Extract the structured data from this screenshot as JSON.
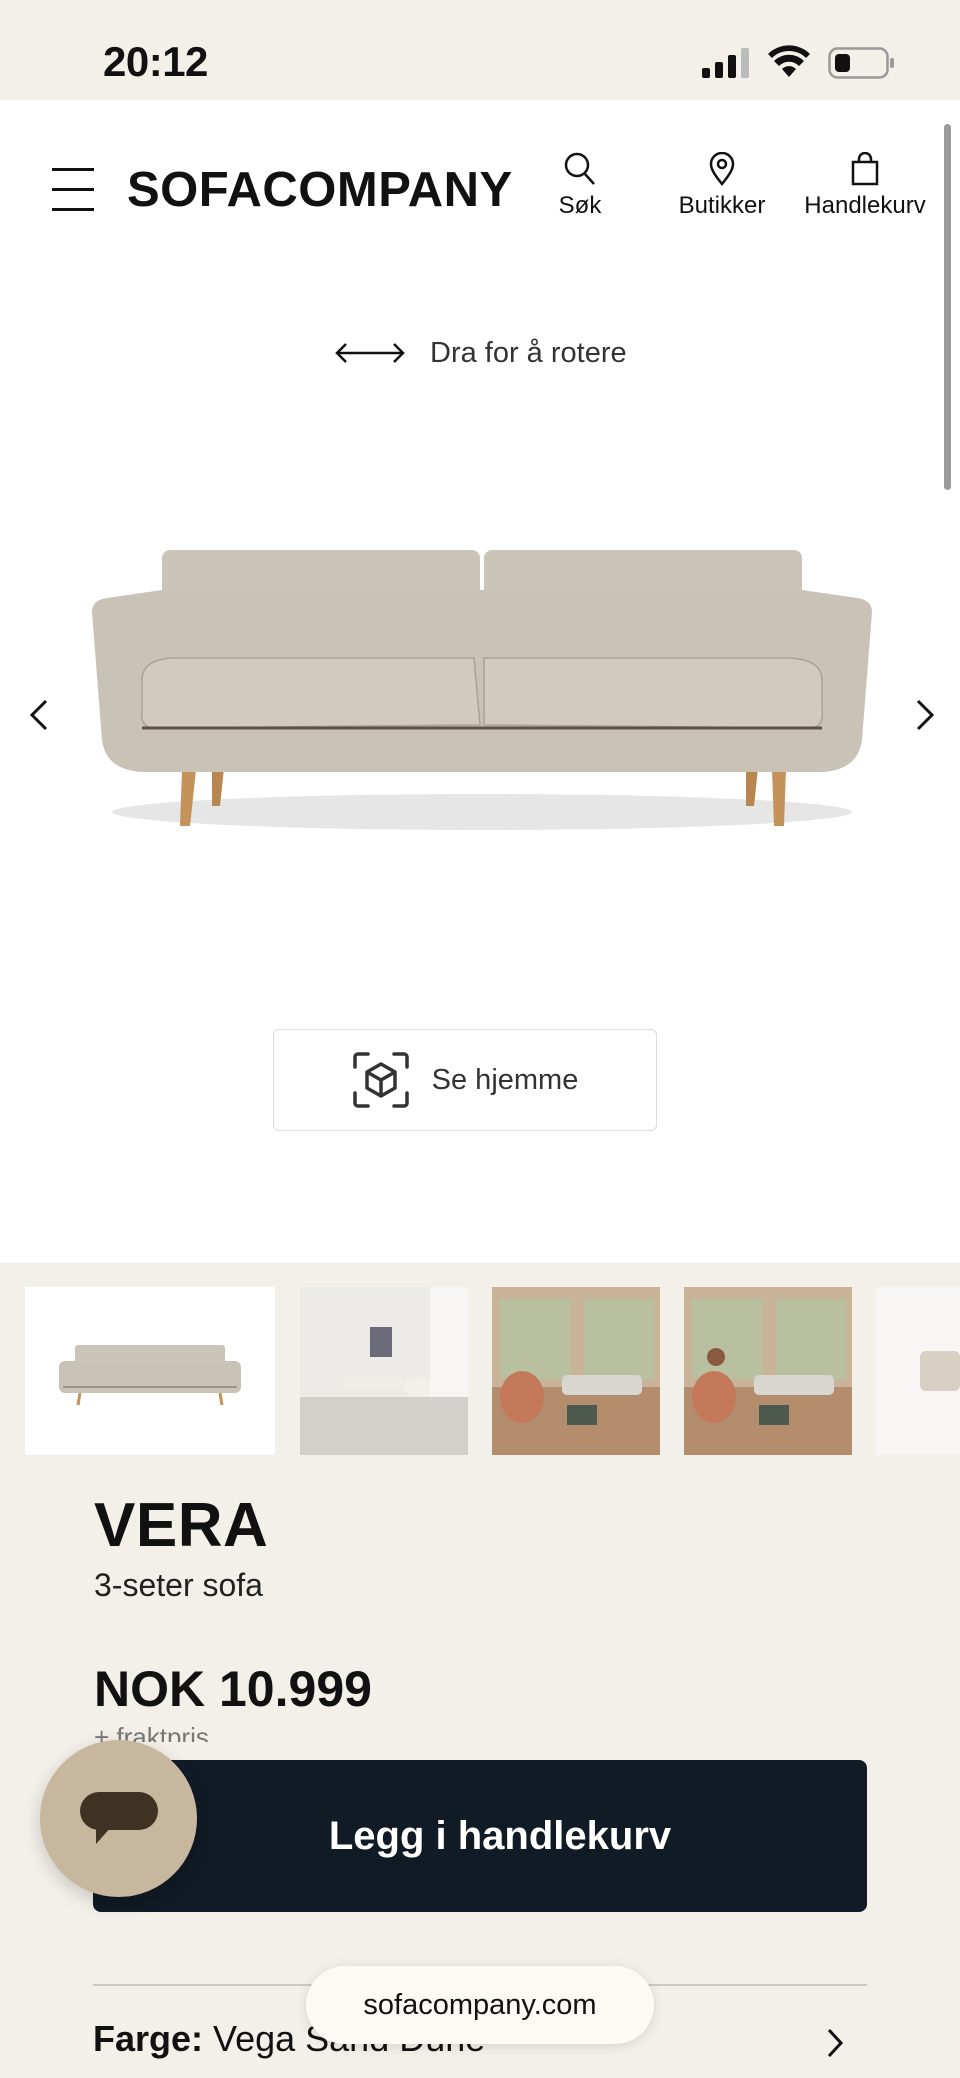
{
  "status": {
    "time": "20:12"
  },
  "header": {
    "logo": "SOFACOMPANY",
    "nav": [
      {
        "label": "Søk",
        "icon": "search-icon"
      },
      {
        "label": "Butikker",
        "icon": "location-pin-icon"
      },
      {
        "label": "Handlekurv",
        "icon": "shopping-bag-icon"
      }
    ]
  },
  "viewer": {
    "rotate_hint": "Dra for å rotere",
    "ar_button": "Se hjemme"
  },
  "product": {
    "name": "VERA",
    "subtitle": "3-seter sofa",
    "price": "NOK 10.999",
    "freight": "+ fraktpris",
    "add_to_cart": "Legg i handlekurv",
    "color_label": "Farge:",
    "color_value": "Vega Sand Dune"
  },
  "browser": {
    "url": "sofacompany.com"
  },
  "colors": {
    "accent_dark": "#111b25",
    "chat_button": "#c7b79f",
    "background": "#f3efe9",
    "sofa_fabric": "#c9c2b6"
  }
}
